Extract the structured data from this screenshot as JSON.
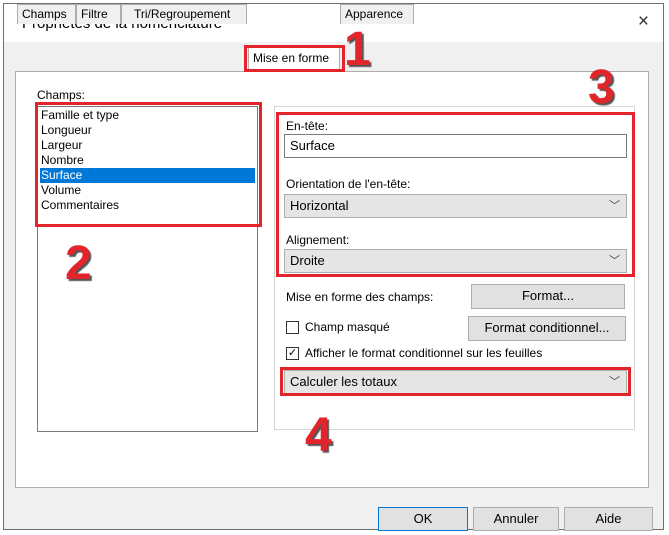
{
  "window": {
    "title": "Propriétés de la nomenclature",
    "close_glyph": "×"
  },
  "tabs": [
    {
      "label": "Champs"
    },
    {
      "label": "Filtre"
    },
    {
      "label": "Tri/Regroupement"
    },
    {
      "label": "Mise en forme"
    },
    {
      "label": "Apparence"
    }
  ],
  "fields": {
    "label": "Champs:",
    "items": [
      "Famille et type",
      "Longueur",
      "Largeur",
      "Nombre",
      "Surface",
      "Volume",
      "Commentaires"
    ],
    "selected": "Surface"
  },
  "heading": {
    "label": "En-tête:",
    "value": "Surface"
  },
  "heading_orientation": {
    "label": "Orientation de l'en-tête:",
    "value": "Horizontal"
  },
  "alignment": {
    "label": "Alignement:",
    "value": "Droite"
  },
  "field_format": {
    "label": "Mise en forme des champs:",
    "button": "Format..."
  },
  "hidden_field": {
    "label": "Champ masqué",
    "checked": false
  },
  "conditional_format": {
    "button": "Format conditionnel..."
  },
  "show_conditional": {
    "label": "Afficher le format conditionnel sur les feuilles",
    "checked": true,
    "check_glyph": "✓"
  },
  "totals": {
    "value": "Calculer les totaux"
  },
  "footer": {
    "ok": "OK",
    "cancel": "Annuler",
    "help": "Aide"
  },
  "annotations": {
    "n1": "1",
    "n2": "2",
    "n3": "3",
    "n4": "4",
    "color": "#e2252b"
  },
  "icons": {
    "chevron": "﹀"
  }
}
